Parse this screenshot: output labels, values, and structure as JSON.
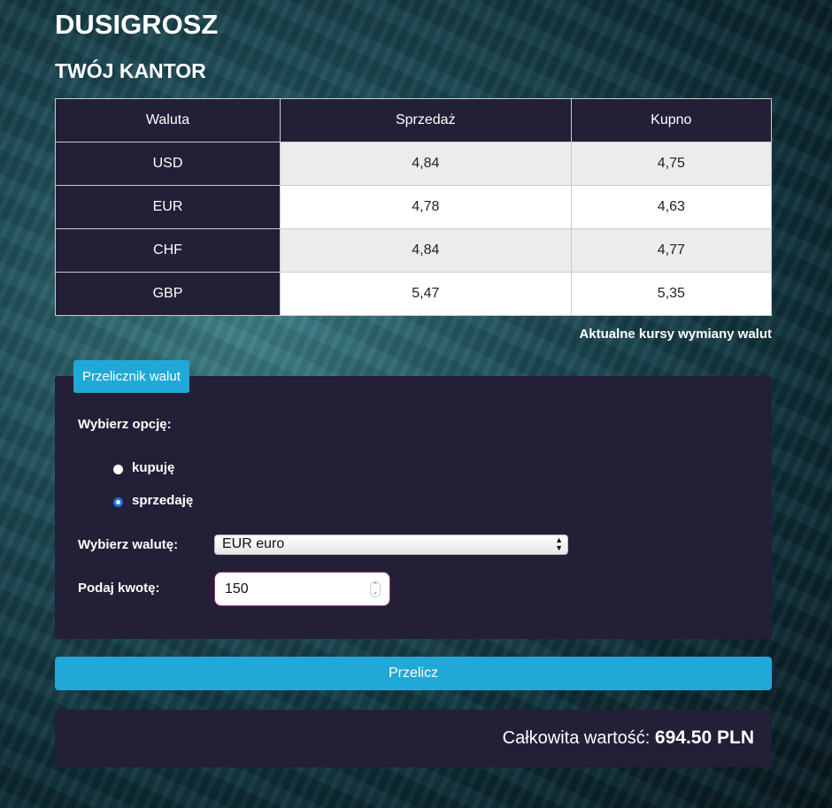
{
  "header": {
    "title": "DUSIGROSZ",
    "subtitle": "TWÓJ KANTOR"
  },
  "rates": {
    "columns": [
      "Waluta",
      "Sprzedaż",
      "Kupno"
    ],
    "rows": [
      [
        "USD",
        "4,84",
        "4,75"
      ],
      [
        "EUR",
        "4,78",
        "4,63"
      ],
      [
        "CHF",
        "4,84",
        "4,77"
      ],
      [
        "GBP",
        "5,47",
        "5,35"
      ]
    ],
    "caption": "Aktualne kursy wymiany walut"
  },
  "converter": {
    "tab": "Przelicznik walut",
    "option_label": "Wybierz opcję:",
    "options": [
      {
        "label": "kupuję",
        "checked": false
      },
      {
        "label": "sprzedaję",
        "checked": true
      }
    ],
    "currency_label": "Wybierz walutę:",
    "currency_value": "EUR euro",
    "amount_label": "Podaj kwotę:",
    "amount_value": "150",
    "button": "Przelicz"
  },
  "result": {
    "label": "Całkowita wartość:",
    "value": "694.50 PLN"
  },
  "colors": {
    "accent": "#20a9d6",
    "panel": "#221f37"
  }
}
